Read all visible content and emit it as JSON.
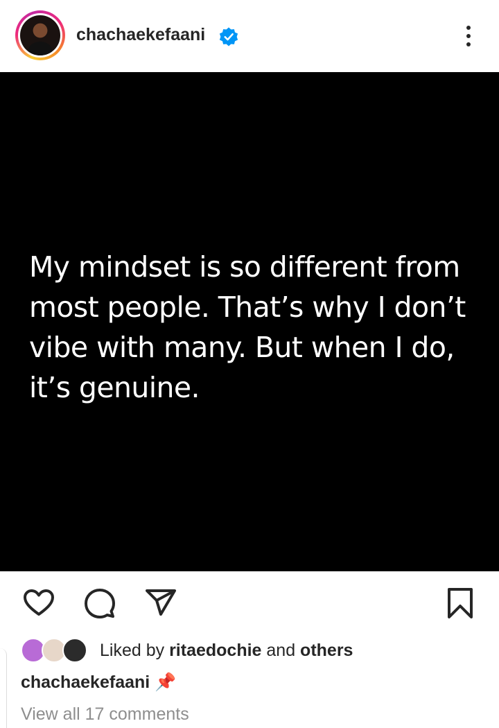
{
  "header": {
    "username": "chachaekefaani",
    "verified_icon": "verified-badge-icon",
    "more_icon": "more-vertical-icon"
  },
  "post": {
    "quote_lines": [
      "My mindset is so different from",
      "most people. That’s why I don’t",
      "vibe with many. But when I do,",
      "it’s genuine."
    ]
  },
  "actions": {
    "icons": [
      "heart-icon",
      "comment-icon",
      "share-icon",
      "bookmark-icon"
    ]
  },
  "likes": {
    "prefix": "Liked by ",
    "user": "ritaedochie",
    "middle": " and ",
    "others": "others",
    "avatar_colors": [
      "#b86bd6",
      "#e7d7c9",
      "#2b2b2b"
    ]
  },
  "caption": {
    "username": "chachaekefaani",
    "emoji": "📌"
  },
  "comments": {
    "label": "View all 17 comments"
  },
  "colors": {
    "verified": "#0095f6",
    "text": "#262626",
    "muted": "#8e8e8e",
    "post_bg": "#000000"
  }
}
